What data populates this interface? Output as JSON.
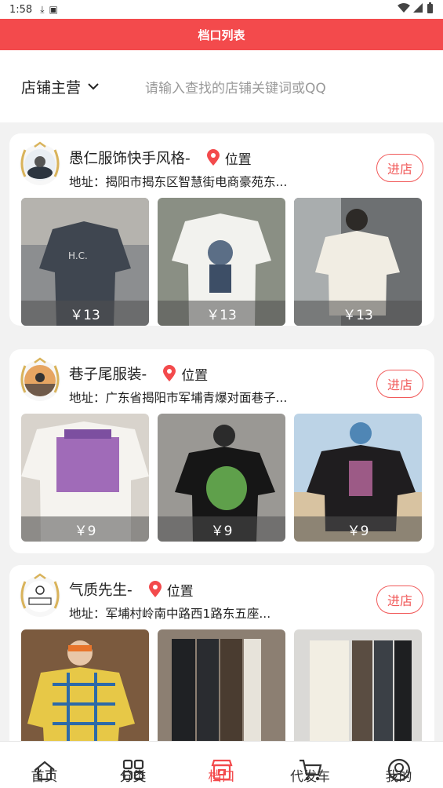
{
  "status_bar": {
    "time": "1:58"
  },
  "header": {
    "title": "档口列表"
  },
  "search": {
    "category_label": "店铺主营",
    "placeholder": "请输入查找的店铺关键词或QQ"
  },
  "shops": [
    {
      "name": "愚仁服饰快手风格-",
      "location_label": "位置",
      "address": "地址：揭阳市揭东区智慧街电商豪苑东...",
      "enter_label": "进店",
      "products": [
        {
          "price": "￥13"
        },
        {
          "price": "￥13"
        },
        {
          "price": "￥13"
        }
      ]
    },
    {
      "name": "巷子尾服装-",
      "location_label": "位置",
      "address": "地址：广东省揭阳市军埔青爆对面巷子...",
      "enter_label": "进店",
      "products": [
        {
          "price": "￥9"
        },
        {
          "price": "￥9"
        },
        {
          "price": "￥9"
        }
      ]
    },
    {
      "name": "气质先生-",
      "location_label": "位置",
      "address": "地址：军埔村岭南中路西1路东五座...",
      "enter_label": "进店",
      "products": [
        {
          "price": ""
        },
        {
          "price": ""
        },
        {
          "price": ""
        }
      ]
    }
  ],
  "tab_bar": {
    "tabs": [
      {
        "label": "首页",
        "icon": "home-icon"
      },
      {
        "label": "分类",
        "icon": "grid-icon"
      },
      {
        "label": "档口",
        "icon": "stall-icon"
      },
      {
        "label": "代发车",
        "icon": "cart-icon"
      },
      {
        "label": "我的",
        "icon": "user-icon"
      }
    ],
    "active_index": 2
  },
  "colors": {
    "accent": "#f34a4c",
    "enter_button": "#f15a5a"
  }
}
